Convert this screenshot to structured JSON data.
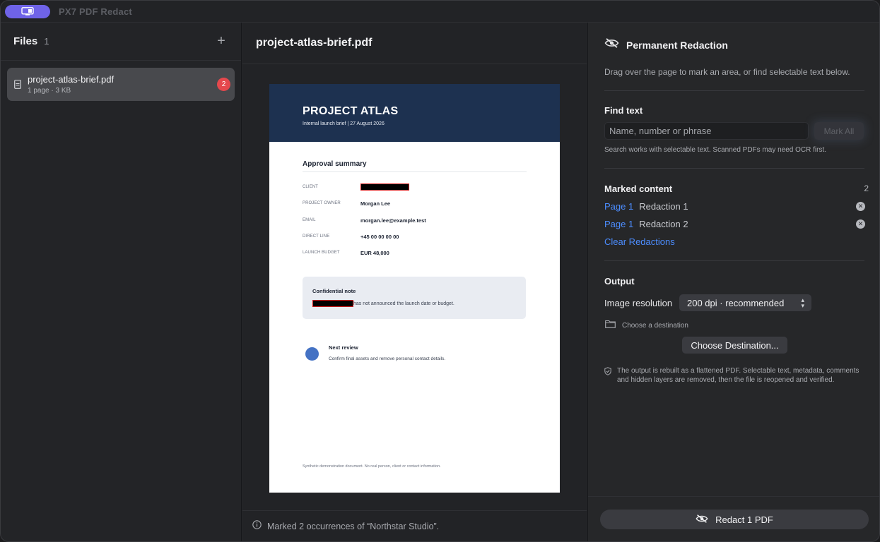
{
  "app": {
    "title": "PX7 PDF Redact"
  },
  "sidebar": {
    "title": "Files",
    "count": "1",
    "add_label": "+",
    "files": [
      {
        "name": "project-atlas-brief.pdf",
        "meta": "1 page · 3 KB",
        "badge": "2"
      }
    ]
  },
  "document": {
    "title": "project-atlas-brief.pdf",
    "page": {
      "title": "PROJECT ATLAS",
      "subtitle": "Internal launch brief | 27 August 2026",
      "section": "Approval summary",
      "rows": [
        {
          "label": "CLIENT",
          "value": ""
        },
        {
          "label": "PROJECT OWNER",
          "value": "Morgan Lee"
        },
        {
          "label": "EMAIL",
          "value": "morgan.lee@example.test"
        },
        {
          "label": "DIRECT LINE",
          "value": "+45 00 00 00 00"
        },
        {
          "label": "LAUNCH BUDGET",
          "value": "EUR 48,000"
        }
      ],
      "note_title": "Confidential note",
      "note_text": "has not announced the launch date or budget.",
      "next_title": "Next review",
      "next_text": "Confirm final assets and remove personal contact details.",
      "footer": "Synthetic demonstration document. No real person, client or contact information."
    }
  },
  "status": {
    "text": "Marked 2 occurrences of “Northstar Studio”."
  },
  "panel": {
    "title": "Permanent Redaction",
    "description": "Drag over the page to mark an area, or find selectable text below.",
    "find": {
      "heading": "Find text",
      "placeholder": "Name, number or phrase",
      "mark_all": "Mark All",
      "hint": "Search works with selectable text. Scanned PDFs may need OCR first."
    },
    "marked": {
      "heading": "Marked content",
      "count": "2",
      "items": [
        {
          "page": "Page 1",
          "name": "Redaction 1"
        },
        {
          "page": "Page 1",
          "name": "Redaction 2"
        }
      ],
      "clear": "Clear Redactions"
    },
    "output": {
      "heading": "Output",
      "resolution_label": "Image resolution",
      "resolution_value": "200 dpi · recommended",
      "destination_text": "Choose a destination",
      "destination_button": "Choose Destination...",
      "note": "The output is rebuilt as a flattened PDF. Selectable text, metadata, comments and hidden layers are removed, then the file is reopened and verified."
    },
    "action": "Redact 1 PDF"
  },
  "colors": {
    "accent": "#4c8dff",
    "badge": "#e5484d",
    "app_pill": "#6f63e8",
    "page_header": "#1d3150"
  }
}
